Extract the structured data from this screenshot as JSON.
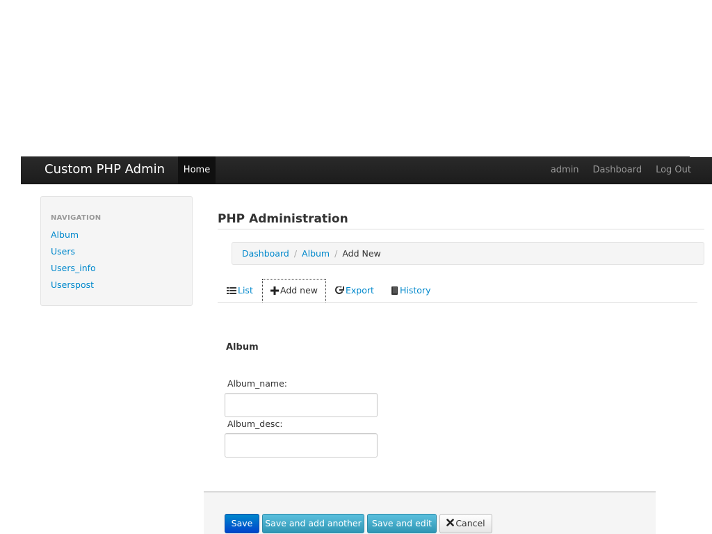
{
  "navbar": {
    "brand": "Custom PHP Admin",
    "home": "Home",
    "user": "admin",
    "dashboard": "Dashboard",
    "logout": "Log Out"
  },
  "sidebar": {
    "header": "NAVIGATION",
    "items": [
      {
        "label": "Album"
      },
      {
        "label": "Users"
      },
      {
        "label": "Users_info"
      },
      {
        "label": "Userspost"
      }
    ]
  },
  "main": {
    "title": "PHP Administration",
    "breadcrumb": [
      {
        "label": "Dashboard"
      },
      {
        "label": "Album"
      },
      {
        "label": "Add New"
      }
    ],
    "breadcrumb_separator": "/",
    "tabs": [
      {
        "label": "List",
        "icon": "list-icon"
      },
      {
        "label": "Add new",
        "icon": "plus-icon"
      },
      {
        "label": "Export",
        "icon": "export-icon"
      },
      {
        "label": "History",
        "icon": "book-icon"
      }
    ],
    "active_tab": "Add new"
  },
  "form": {
    "legend": "Album",
    "fields": [
      {
        "label": "Album_name:",
        "value": "",
        "placeholder": ""
      },
      {
        "label": "Album_desc:",
        "value": "",
        "placeholder": ""
      }
    ]
  },
  "actions": {
    "save": "Save",
    "save_add_another": "Save and add another",
    "save_edit": "Save and edit",
    "cancel": "Cancel"
  },
  "colors": {
    "navbar": "#222222",
    "link": "#0088cc",
    "primary_button": "#0055cc",
    "info_button": "#49afcd"
  }
}
